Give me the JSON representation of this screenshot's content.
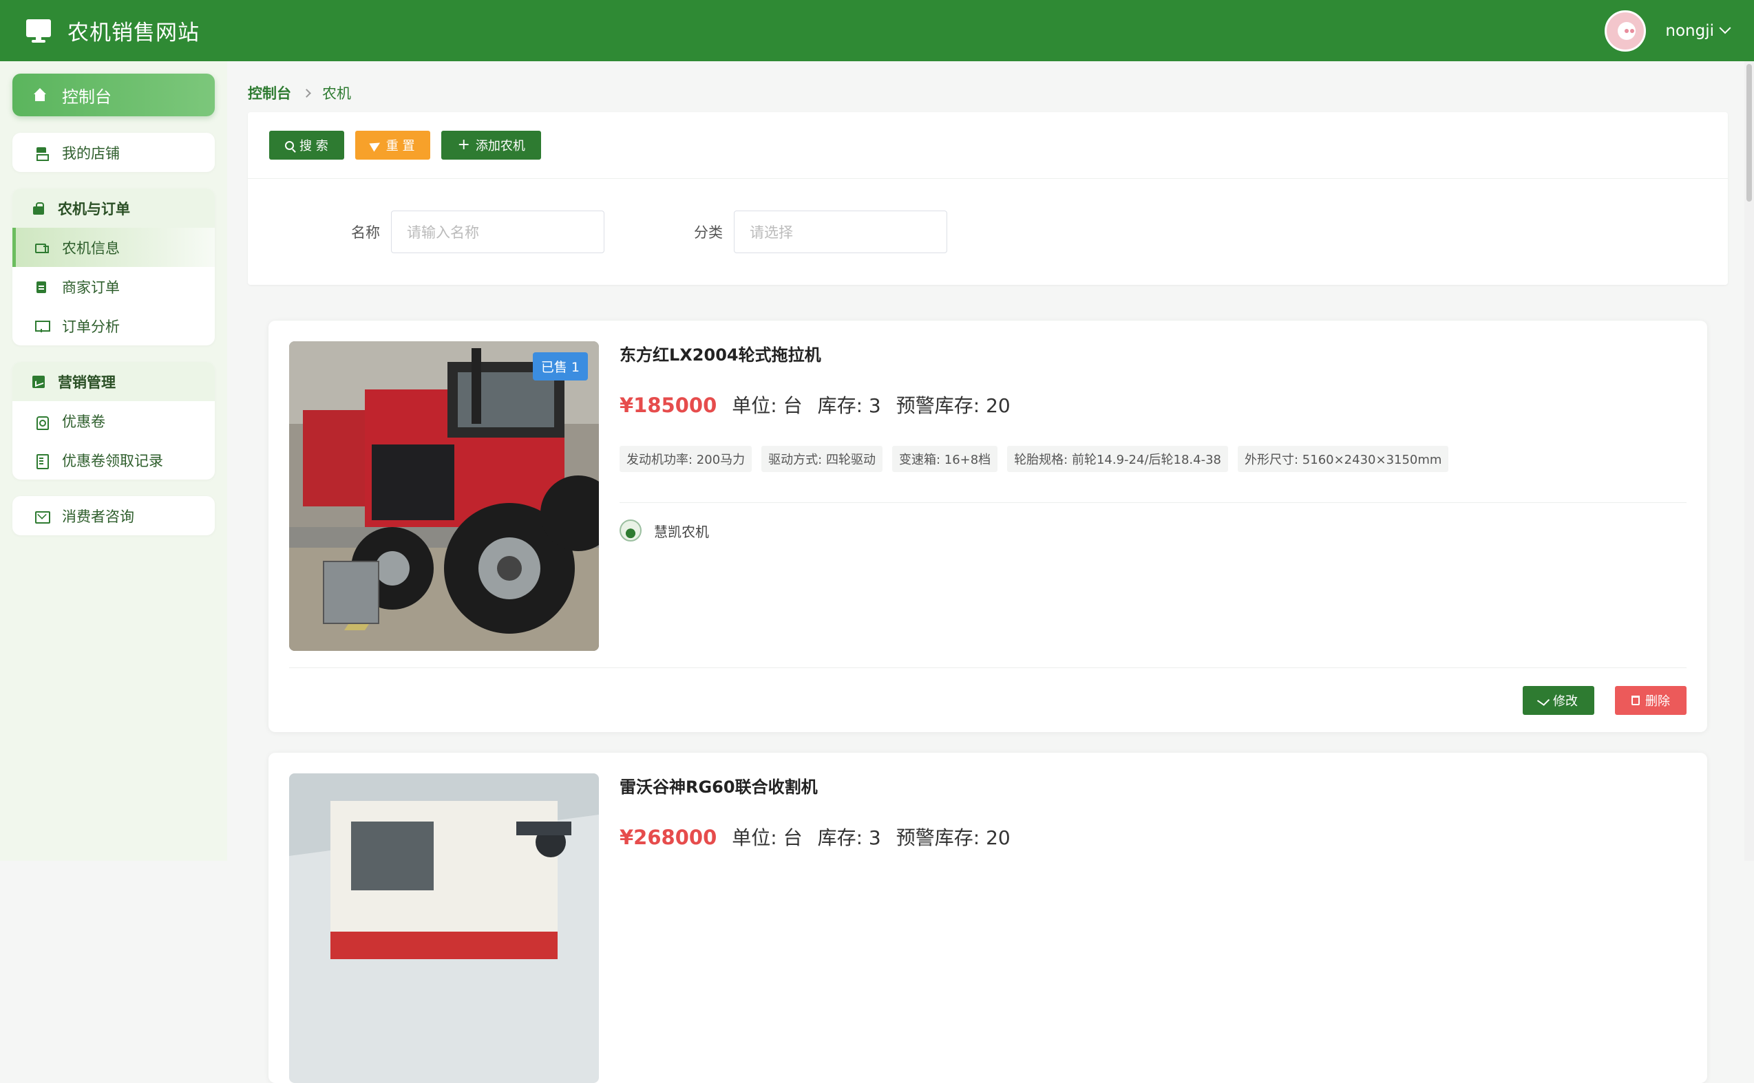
{
  "app": {
    "title": "农机销售网站",
    "username": "nongji"
  },
  "sidebar": {
    "dashboard": "控制台",
    "my_shop": "我的店铺",
    "groups": [
      {
        "title": "农机与订单",
        "items": [
          "农机信息",
          "商家订单",
          "订单分析"
        ],
        "active": 0
      },
      {
        "title": "营销管理",
        "items": [
          "优惠卷",
          "优惠卷领取记录"
        ]
      }
    ],
    "consult": "消费者咨询"
  },
  "breadcrumb": {
    "root": "控制台",
    "current": "农机"
  },
  "toolbar": {
    "search": "搜 索",
    "reset": "重 置",
    "add": "添加农机"
  },
  "filters": {
    "name_label": "名称",
    "name_placeholder": "请输入名称",
    "category_label": "分类",
    "category_placeholder": "请选择"
  },
  "products": [
    {
      "name": "东方红LX2004轮式拖拉机",
      "price": "¥185000",
      "unit": "单位: 台",
      "stock": "库存: 3",
      "warn_stock": "预警库存: 20",
      "sold_badge": "已售 1",
      "specs": [
        "发动机功率: 200马力",
        "驱动方式: 四轮驱动",
        "变速箱: 16+8档",
        "轮胎规格: 前轮14.9-24/后轮18.4-38",
        "外形尺寸: 5160×2430×3150mm"
      ],
      "seller": "慧凯农机",
      "edit": "修改",
      "delete": "删除"
    },
    {
      "name": "雷沃谷神RG60联合收割机",
      "price": "¥268000",
      "unit": "单位: 台",
      "stock": "库存: 3",
      "warn_stock": "预警库存: 20"
    }
  ],
  "colors": {
    "brand": "#2f8a34",
    "accent_orange": "#f7a12a",
    "danger": "#ec5a5a",
    "price": "#e64c4c",
    "badge": "#3b8de0"
  }
}
